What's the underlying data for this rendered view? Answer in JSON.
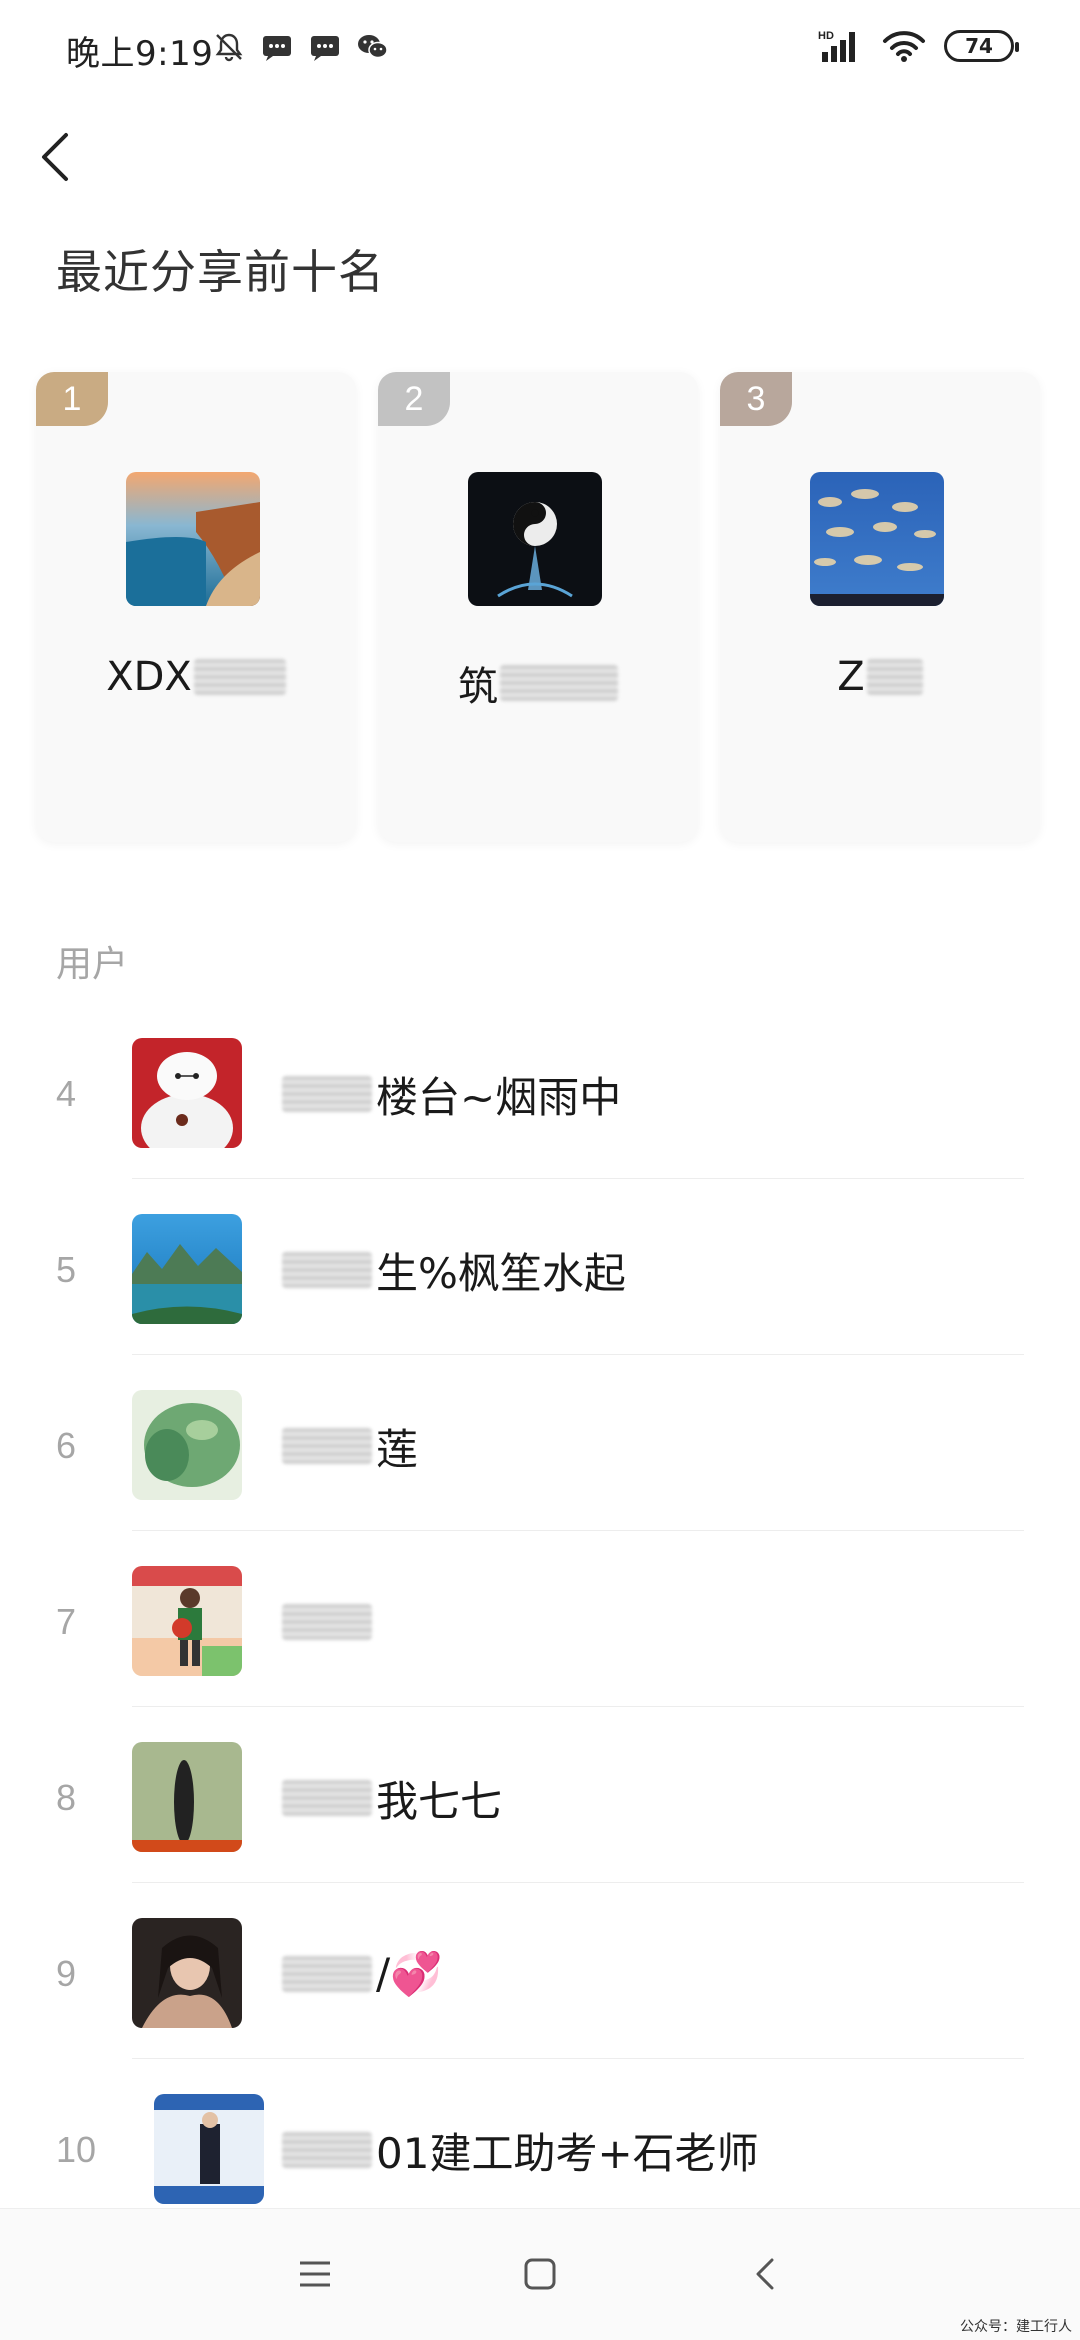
{
  "status_bar": {
    "time": "晚上9:19",
    "icons": [
      "bell-off-icon",
      "message-icon",
      "message-icon",
      "wechat-icon"
    ],
    "network_label": "HD",
    "battery": "74"
  },
  "header": {
    "title": "最近分享前十名"
  },
  "top3": [
    {
      "rank": "1",
      "name": "XDX",
      "badge_color": "#c9ab83"
    },
    {
      "rank": "2",
      "name": "筑",
      "badge_color": "#c2c2c2"
    },
    {
      "rank": "3",
      "name": "Z",
      "badge_color": "#b8a79c"
    }
  ],
  "section_label": "用户",
  "users": [
    {
      "rank": "4",
      "name": "楼台~烟雨中"
    },
    {
      "rank": "5",
      "name": "生%枫笙水起"
    },
    {
      "rank": "6",
      "name": "莲"
    },
    {
      "rank": "7",
      "name": ""
    },
    {
      "rank": "8",
      "name": "我七七"
    },
    {
      "rank": "9",
      "name": "/💞"
    },
    {
      "rank": "10",
      "name": "01建工助考+石老师"
    }
  ],
  "watermark": "公众号：建工行人"
}
